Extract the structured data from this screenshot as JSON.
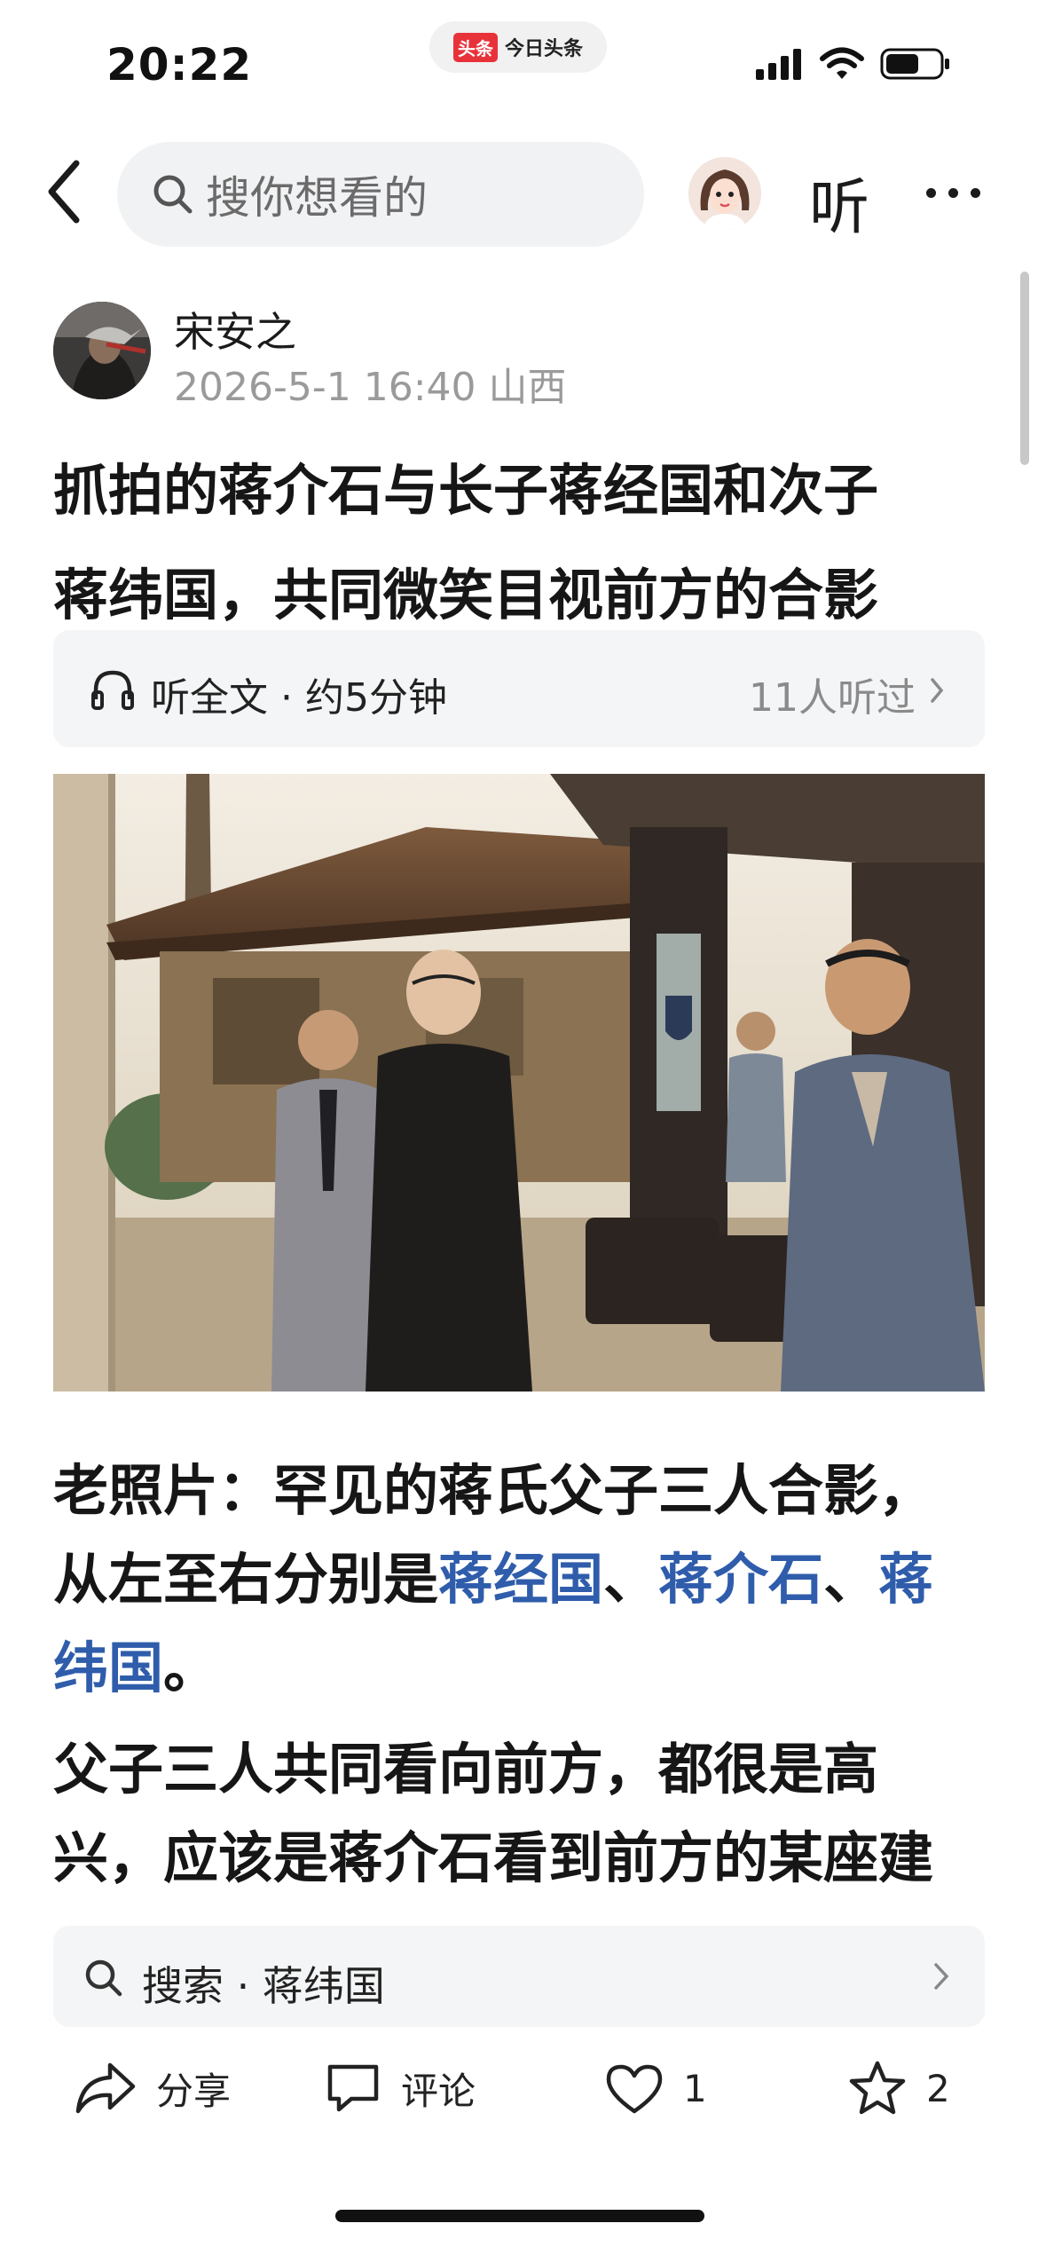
{
  "status_bar": {
    "time": "20:22",
    "island_logo": "头条",
    "island_app": "今日头条"
  },
  "nav": {
    "search_placeholder": "搜你想看的",
    "listen_label": "听"
  },
  "author": {
    "name": "宋安之",
    "meta": "2026-5-1 16:40 山西"
  },
  "article": {
    "title_lines": [
      "抓拍的蒋介石与长子蒋经国和次子",
      "蒋纬国，共同微笑目视前方的合影"
    ],
    "listen_bar": {
      "label": "听全文 · 约5分钟",
      "count": "11人听过"
    },
    "para1": {
      "line1": "老照片：罕见的蒋氏父子三人合影，",
      "line2_prefix": "从左至右分别是",
      "link1": "蒋经国",
      "sep1": "、",
      "link2": "蒋介石",
      "sep2": "、",
      "link3a": "蒋",
      "link3b": "纬国",
      "end": "。"
    },
    "para2": {
      "line1": "父子三人共同看向前方，都很是高",
      "line2": "兴，应该是蒋介石看到前方的某座建"
    }
  },
  "related_search": {
    "label": "搜索 · 蒋纬国"
  },
  "actions": {
    "share": "分享",
    "comment": "评论",
    "like_count": "1",
    "favorite_count": "2"
  },
  "colors": {
    "link": "#2f5dab",
    "accent_red": "#e8323a"
  }
}
